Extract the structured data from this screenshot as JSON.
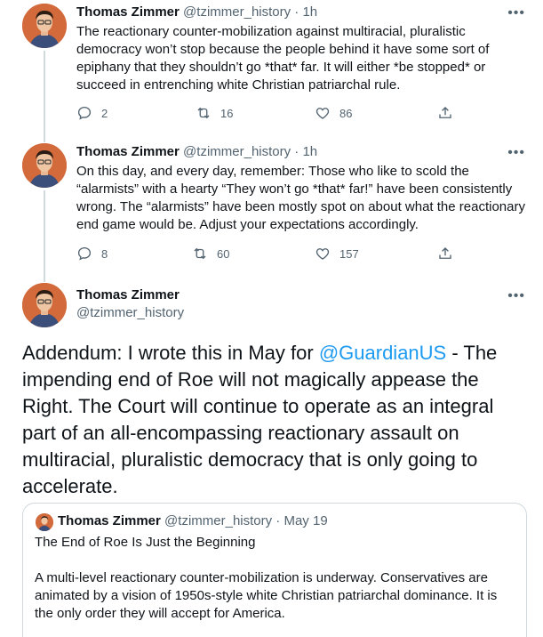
{
  "tweets": [
    {
      "name": "Thomas Zimmer",
      "handle": "@tzimmer_history",
      "separator": "·",
      "time": "1h",
      "more": "•••",
      "text": "The reactionary counter-mobilization against multiracial, pluralistic democracy won’t stop because the people behind it have some sort of epiphany that they shouldn’t go *that* far. It will either *be stopped* or succeed in entrenching white Christian patriarchal rule.",
      "replies": "2",
      "retweets": "16",
      "likes": "86"
    },
    {
      "name": "Thomas Zimmer",
      "handle": "@tzimmer_history",
      "separator": "·",
      "time": "1h",
      "more": "•••",
      "text": "On this day, and every day, remember: Those who like to scold the “alarmists” with a hearty “They won’t go *that* far!” have been consistently wrong. The “alarmists” have been mostly spot on about what the reactionary end game would be. Adjust your expectations accordingly.",
      "replies": "8",
      "retweets": "60",
      "likes": "157"
    }
  ],
  "main": {
    "name": "Thomas Zimmer",
    "handle": "@tzimmer_history",
    "more": "•••",
    "text_before": "Addendum: I wrote this in May for ",
    "mention": "@GuardianUS",
    "text_after": " - The impending end of Roe will not magically appease the Right. The Court will continue to operate as an integral part of an all-encompassing reactionary assault on multiracial, pluralistic democracy that is only going to accelerate."
  },
  "quote": {
    "name": "Thomas Zimmer",
    "handle": "@tzimmer_history",
    "separator": "·",
    "time": "May 19",
    "title": "The End of Roe Is Just the Beginning",
    "body": "A multi-level reactionary counter-mobilization is underway. Conservatives are animated by a vision of 1950s-style white Christian patriarchal dominance. It is the only order they will accept for America."
  },
  "colors": {
    "accent": "#1d9bf0",
    "secondary_text": "#536471",
    "border": "#cfd9de",
    "avatar_bg": "#d26a3c"
  }
}
